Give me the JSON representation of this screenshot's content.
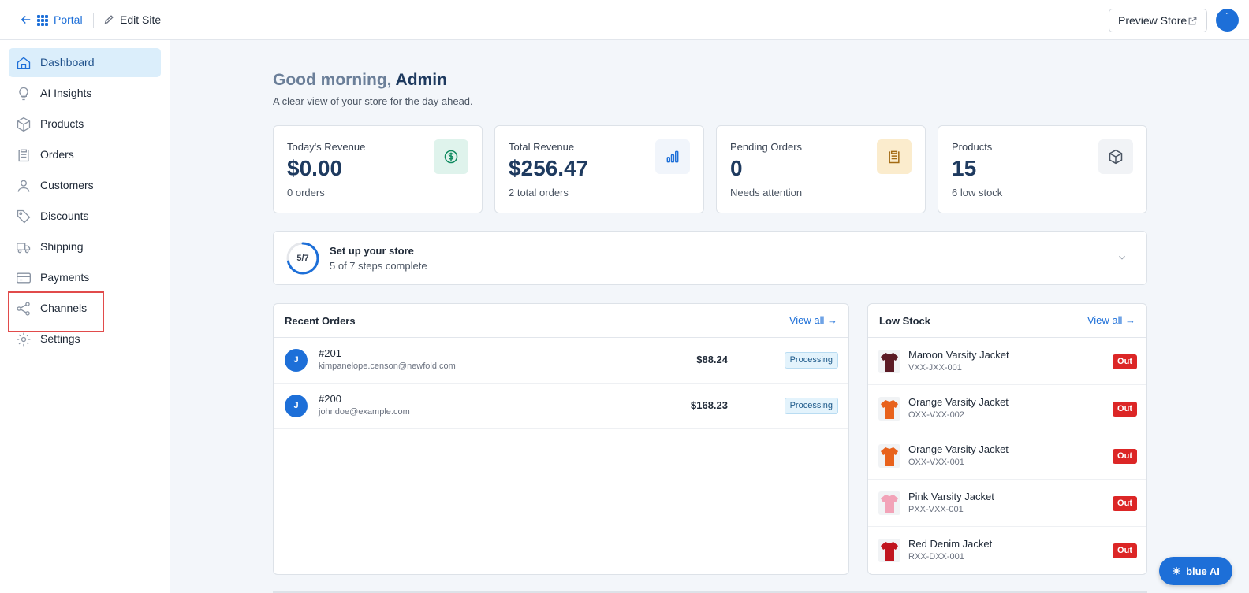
{
  "topbar": {
    "portal_label": "Portal",
    "edit_site_label": "Edit Site",
    "preview_label": "Preview Store",
    "avatar_initial": "ˆ"
  },
  "sidebar": {
    "items": [
      {
        "label": "Dashboard",
        "icon": "home-icon",
        "active": true
      },
      {
        "label": "AI Insights",
        "icon": "lightbulb-icon"
      },
      {
        "label": "Products",
        "icon": "box-icon"
      },
      {
        "label": "Orders",
        "icon": "clipboard-icon"
      },
      {
        "label": "Customers",
        "icon": "user-icon"
      },
      {
        "label": "Discounts",
        "icon": "tag-icon"
      },
      {
        "label": "Shipping",
        "icon": "truck-icon"
      },
      {
        "label": "Payments",
        "icon": "credit-card-icon"
      },
      {
        "label": "Channels",
        "icon": "share-icon"
      },
      {
        "label": "Settings",
        "icon": "gear-icon"
      }
    ]
  },
  "greeting": {
    "prefix": "Good morning",
    "comma": ",",
    "name": " Admin",
    "subtitle": "A clear view of your store for the day ahead."
  },
  "stats": [
    {
      "label": "Today's Revenue",
      "value": "$0.00",
      "note": "0 orders",
      "icon": "dollar-icon",
      "icon_bg": "#dff3ec",
      "icon_color": "#0f8a5f"
    },
    {
      "label": "Total Revenue",
      "value": "$256.47",
      "note": "2 total orders",
      "icon": "bar-chart-icon",
      "icon_bg": "#f1f5fb",
      "icon_color": "#1d6fd8"
    },
    {
      "label": "Pending Orders",
      "value": "0",
      "note": "Needs attention",
      "icon": "clipboard-icon",
      "icon_bg": "#fbeccd",
      "icon_color": "#a36a12"
    },
    {
      "label": "Products",
      "value": "15",
      "note": "6 low stock",
      "icon": "box-icon",
      "icon_bg": "#f1f3f6",
      "icon_color": "#4b5563"
    }
  ],
  "setup": {
    "progress_label": "5/7",
    "progress_fraction": 0.714,
    "title": "Set up your store",
    "subtitle": "5 of 7 steps complete"
  },
  "recent_orders": {
    "title": "Recent Orders",
    "view_all": "View all →",
    "rows": [
      {
        "initial": "J",
        "number": "#201",
        "email": "kimpanelope.censon@newfold.com",
        "amount": "$88.24",
        "status": "Processing"
      },
      {
        "initial": "J",
        "number": "#200",
        "email": "johndoe@example.com",
        "amount": "$168.23",
        "status": "Processing"
      }
    ]
  },
  "low_stock": {
    "title": "Low Stock",
    "view_all": "View all →",
    "rows": [
      {
        "name": "Maroon Varsity Jacket",
        "sku": "VXX-JXX-001",
        "badge": "Out",
        "color": "#5a1a24"
      },
      {
        "name": "Orange Varsity Jacket",
        "sku": "OXX-VXX-002",
        "badge": "Out",
        "color": "#e8621c"
      },
      {
        "name": "Orange Varsity Jacket",
        "sku": "OXX-VXX-001",
        "badge": "Out",
        "color": "#e8621c"
      },
      {
        "name": "Pink Varsity Jacket",
        "sku": "PXX-VXX-001",
        "badge": "Out",
        "color": "#f2a3b8"
      },
      {
        "name": "Red Denim Jacket",
        "sku": "RXX-DXX-001",
        "badge": "Out",
        "color": "#c0141e"
      }
    ]
  },
  "ai_button": {
    "label": "blue AI"
  }
}
